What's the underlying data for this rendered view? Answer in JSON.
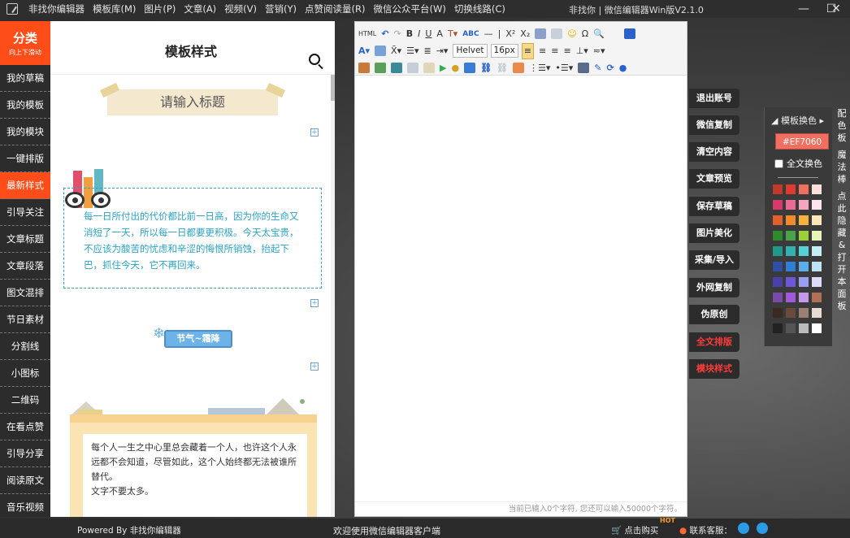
{
  "titlebar": {
    "menus": [
      "非找你编辑器",
      "模板库(M)",
      "图片(P)",
      "文章(A)",
      "视频(V)",
      "营销(Y)",
      "点赞阅读量(R)",
      "微信公众平台(W)",
      "切换线路(C)"
    ],
    "title": "非找你 | 微信编辑器Win版V2.1.0",
    "minimize": "—",
    "maximize": "☐",
    "close": "✕"
  },
  "category": {
    "title": "分类",
    "subtitle": "向上下滑动"
  },
  "nav": [
    "我的草稿",
    "我的模板",
    "我的模块",
    "一键排版",
    "最新样式",
    "引导关注",
    "文章标题",
    "文章段落",
    "图文混排",
    "节日素材",
    "分割线",
    "小图标",
    "二维码",
    "在看点赞",
    "引导分享",
    "阅读原文",
    "音乐视频"
  ],
  "nav_active": "最新样式",
  "template_panel": {
    "title": "模板样式",
    "banner": "请输入标题",
    "quote": "每一日所付出的代价都比前一日高，因为你的生命又消短了一天，所以每一日都要更积极。今天太宝贵，不应该为酸苦的忧虑和辛涩的悔恨所销蚀，抬起下巴，抓住今天，它不再回来。",
    "season_label": "节气~霜降",
    "card_line1": "每个人一生之中心里总会藏着一个人，也许这个人永远都不会知道，尽管如此，这个人始终都无法被谁所替代。",
    "card_line2": "文字不要太多。"
  },
  "editor": {
    "font_family": "Helvet",
    "font_size": "16px",
    "footer": "当前已输入0个字符, 您还可以输入50000个字符。"
  },
  "actions": [
    "退出账号",
    "微信复制",
    "清空内容",
    "文章预览",
    "保存草稿",
    "图片美化",
    "采集/导入",
    "外网复制",
    "伪原创",
    "全文排版",
    "模块样式"
  ],
  "color_panel": {
    "title": "模板换色",
    "hex": "#EF7060",
    "full_label": "全文换色",
    "swatches": [
      "#c0392b",
      "#e03a2f",
      "#ef7060",
      "#fde0dc",
      "#d63a6a",
      "#e86a96",
      "#f4a6c1",
      "#fde4ee",
      "#e0622a",
      "#f08a2a",
      "#f6b23a",
      "#fde7b8",
      "#2d8a2d",
      "#4aa34a",
      "#9ad13a",
      "#e8f3b8",
      "#1f9a8a",
      "#35b0b0",
      "#55d2d6",
      "#c5eef2",
      "#2f4fa3",
      "#2f7ed8",
      "#5aaeea",
      "#bfe1f8",
      "#4a3ea8",
      "#6c57d8",
      "#9a9ef2",
      "#dcdcfa",
      "#7a4aa8",
      "#a05ad8",
      "#c49ae8",
      "#b0705a",
      "#3a2a22",
      "#6a4a3a",
      "#9a8070",
      "#e8dcd2",
      "#222222",
      "#555555",
      "#bbbbbb",
      "#ffffff"
    ]
  },
  "side_menu": [
    "配色板",
    "魔法棒",
    "点此隐藏&打开本面板"
  ],
  "statusbar": {
    "powered": "Powered By 非找你编辑器",
    "welcome": "欢迎使用微信编辑器客户端",
    "buy": "点击购买",
    "hot": "HOT",
    "service": "联系客服："
  }
}
